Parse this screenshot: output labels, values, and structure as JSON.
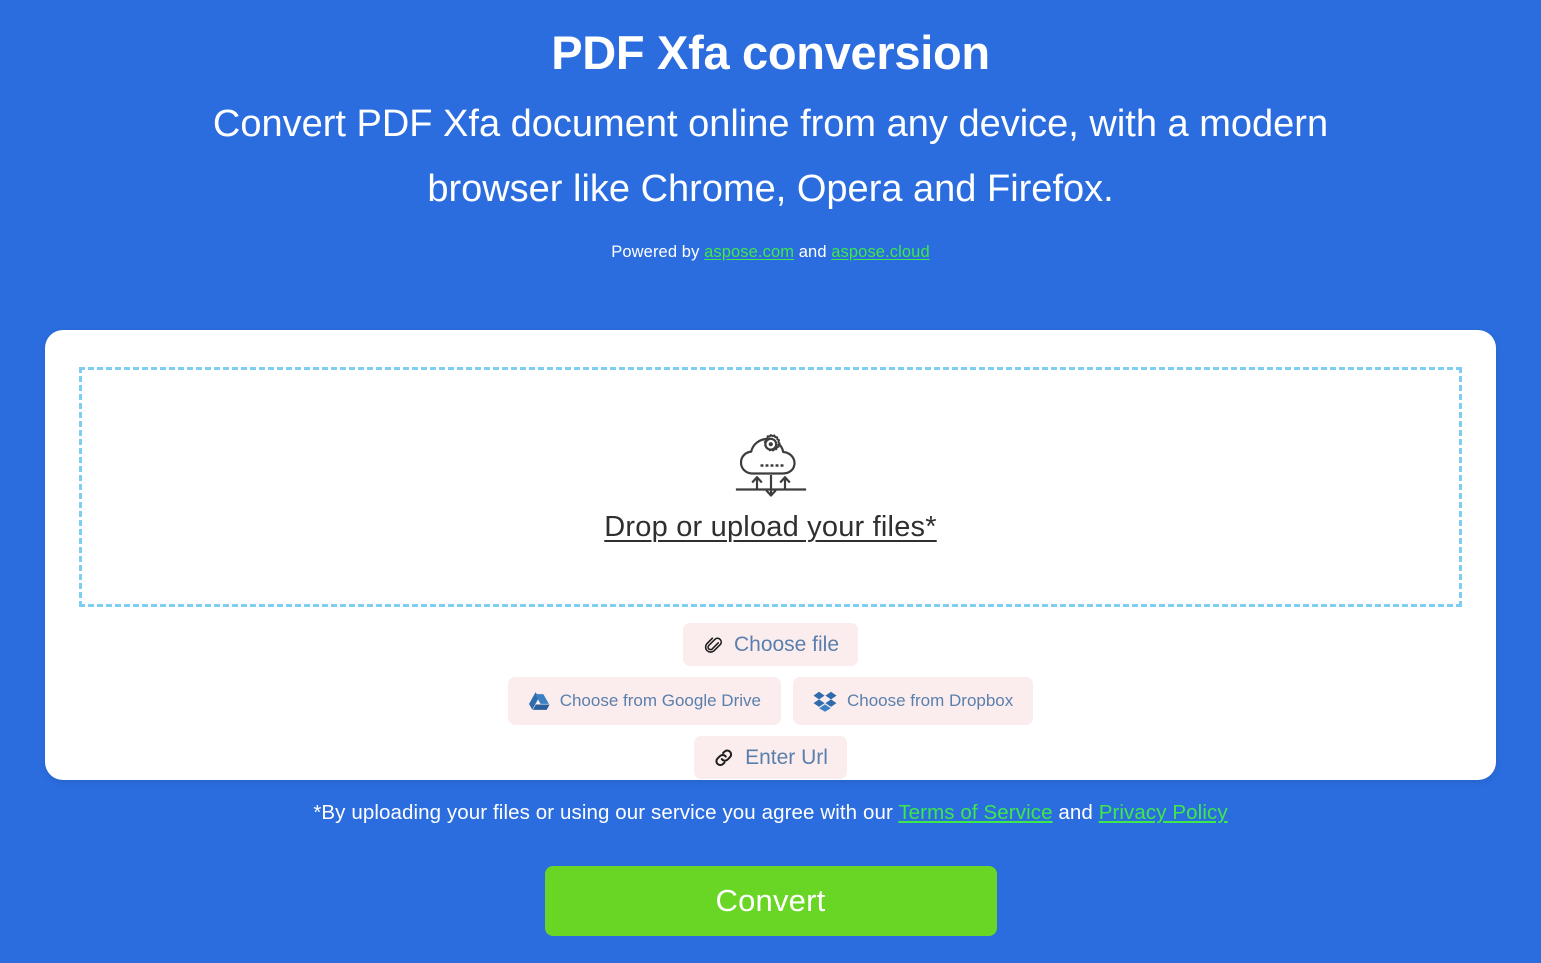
{
  "header": {
    "title": "PDF Xfa conversion",
    "subtitle": "Convert PDF Xfa document online from any device, with a modern browser like Chrome, Opera and Firefox.",
    "powered_by_prefix": "Powered by ",
    "powered_by_link_1": "aspose.com",
    "powered_by_joiner": " and ",
    "powered_by_link_2": "aspose.cloud"
  },
  "dropzone": {
    "label": "Drop or upload your files*",
    "icon": "cloud-gear-upload-icon",
    "border_color": "#7ecef4"
  },
  "sources": {
    "choose_file": {
      "label": "Choose file",
      "icon": "paperclip-icon"
    },
    "google_drive": {
      "label": "Choose from Google Drive",
      "icon": "google-drive-icon"
    },
    "dropbox": {
      "label": "Choose from Dropbox",
      "icon": "dropbox-icon"
    },
    "enter_url": {
      "label": "Enter Url",
      "icon": "link-icon"
    }
  },
  "terms": {
    "prefix": "*By uploading your files or using our service you agree with our ",
    "link_1": "Terms of Service",
    "joiner": " and ",
    "link_2": "Privacy Policy"
  },
  "actions": {
    "convert_label": "Convert"
  },
  "colors": {
    "background": "#2b6ddf",
    "card": "#ffffff",
    "accent_green": "#69d626",
    "link_green": "#3ee84b",
    "button_bg": "#fbeded",
    "button_text": "#5b7fad",
    "dashed_border": "#7ecef4"
  }
}
